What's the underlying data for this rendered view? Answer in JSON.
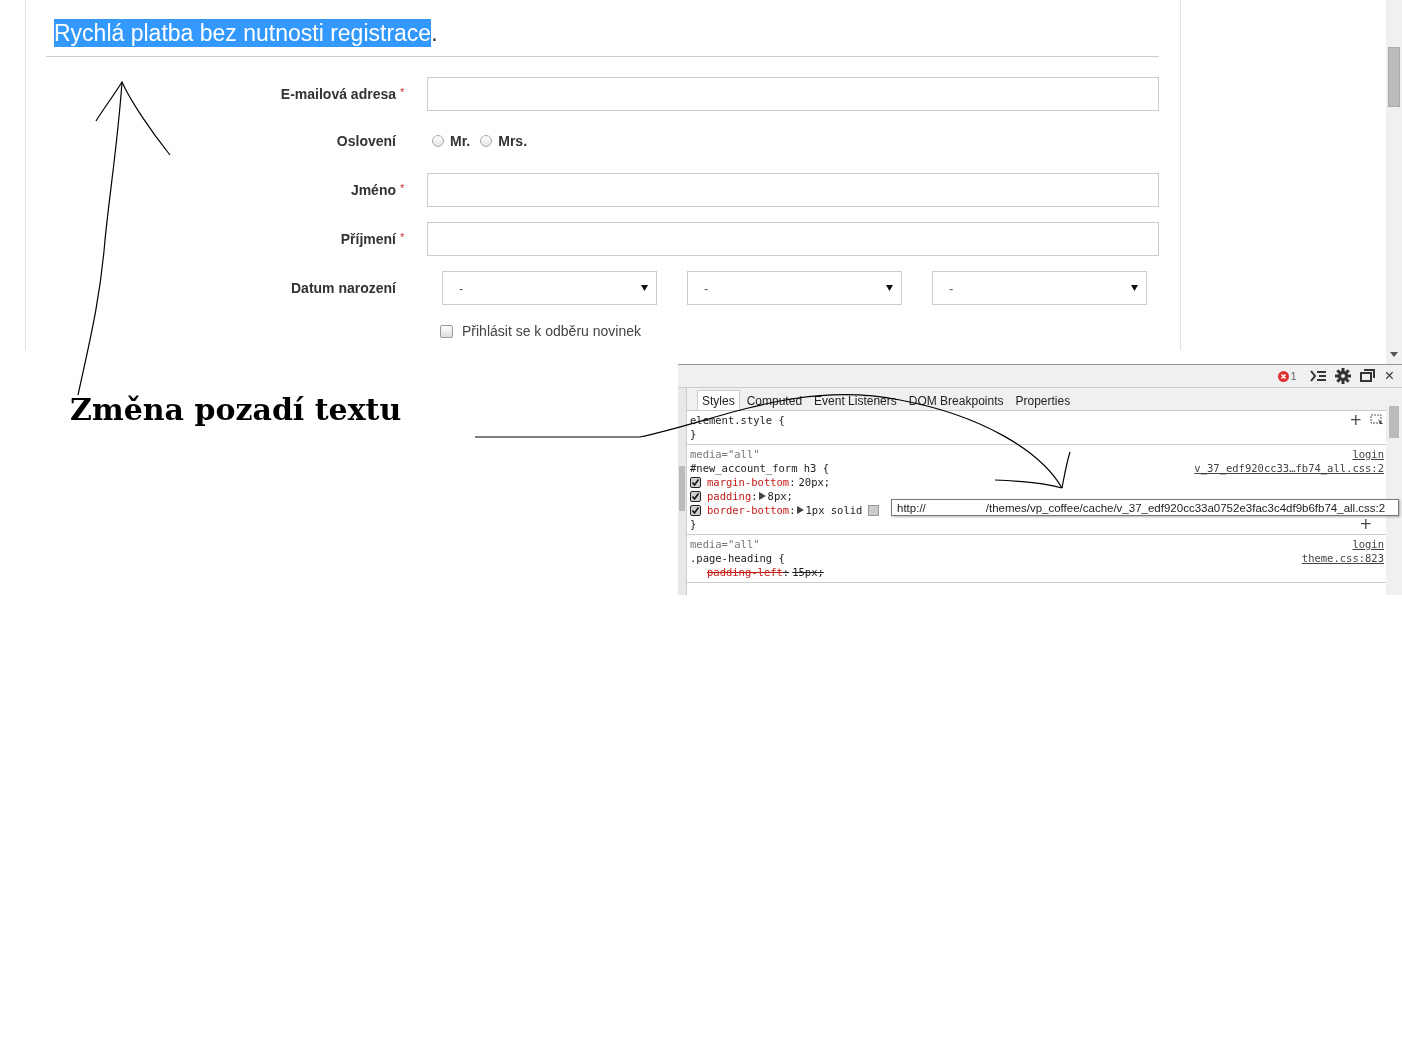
{
  "page": {
    "heading": {
      "text": "Rychlá platba bez nutnosti registrace",
      "suffix": ".",
      "highlighted": true
    },
    "required_mark": "*",
    "fields": [
      {
        "kind": "text",
        "label": "E-mailová adresa",
        "required": true
      },
      {
        "kind": "radio",
        "label": "Oslovení",
        "required": false,
        "options": [
          {
            "label": "Mr.",
            "selected": false
          },
          {
            "label": "Mrs.",
            "selected": false
          }
        ]
      },
      {
        "kind": "text",
        "label": "Jméno",
        "required": true
      },
      {
        "kind": "text",
        "label": "Příjmení",
        "required": true
      },
      {
        "kind": "selects",
        "label": "Datum narození",
        "required": false,
        "selects": [
          {
            "value": "-"
          },
          {
            "value": "-"
          },
          {
            "value": "-"
          }
        ]
      }
    ],
    "newsletter": {
      "label": "Přihlásit se k odběru novinek",
      "checked": false
    }
  },
  "annotation": {
    "text": "Změna pozadí textu"
  },
  "devtools": {
    "error_count": "1",
    "close": "×",
    "tabs": [
      {
        "label": "Styles",
        "selected": true
      },
      {
        "label": "Computed",
        "selected": false
      },
      {
        "label": "Event Listeners",
        "selected": false
      },
      {
        "label": "DOM Breakpoints",
        "selected": false
      },
      {
        "label": "Properties",
        "selected": false
      }
    ],
    "rules": [
      {
        "kind": "inline",
        "selector": "element.style {",
        "close": "}",
        "add": "+"
      },
      {
        "kind": "matched",
        "media": "media=\"all\"",
        "origin": "login",
        "selector": "#new_account_form h3 {",
        "source": "v_37_edf920cc33…fb74_all.css:2",
        "close": "}",
        "add": "+",
        "props": [
          {
            "name": "margin-bottom",
            "sep": ":",
            "value": "20px;",
            "checked": true,
            "expandable": false,
            "swatch": false,
            "overridden": false
          },
          {
            "name": "padding",
            "sep": ":",
            "value": "8px;",
            "checked": true,
            "expandable": true,
            "swatch": false,
            "overridden": false
          },
          {
            "name": "border-bottom",
            "sep": ":",
            "value": "1px solid",
            "checked": true,
            "expandable": true,
            "swatch": true,
            "overridden": false
          }
        ]
      },
      {
        "kind": "matched",
        "media": "media=\"all\"",
        "origin": "login",
        "selector": ".page-heading {",
        "source": "theme.css:823",
        "props": [
          {
            "name": "padding-left",
            "sep": ":",
            "value": "15px;",
            "expandable": false,
            "swatch": false,
            "overridden": true
          }
        ]
      }
    ],
    "tooltip": {
      "start": "http://",
      "end": "/themes/vp_coffee/cache/v_37_edf920cc33a0752e3fac3c4df9b6fb74_all.css:2"
    }
  }
}
